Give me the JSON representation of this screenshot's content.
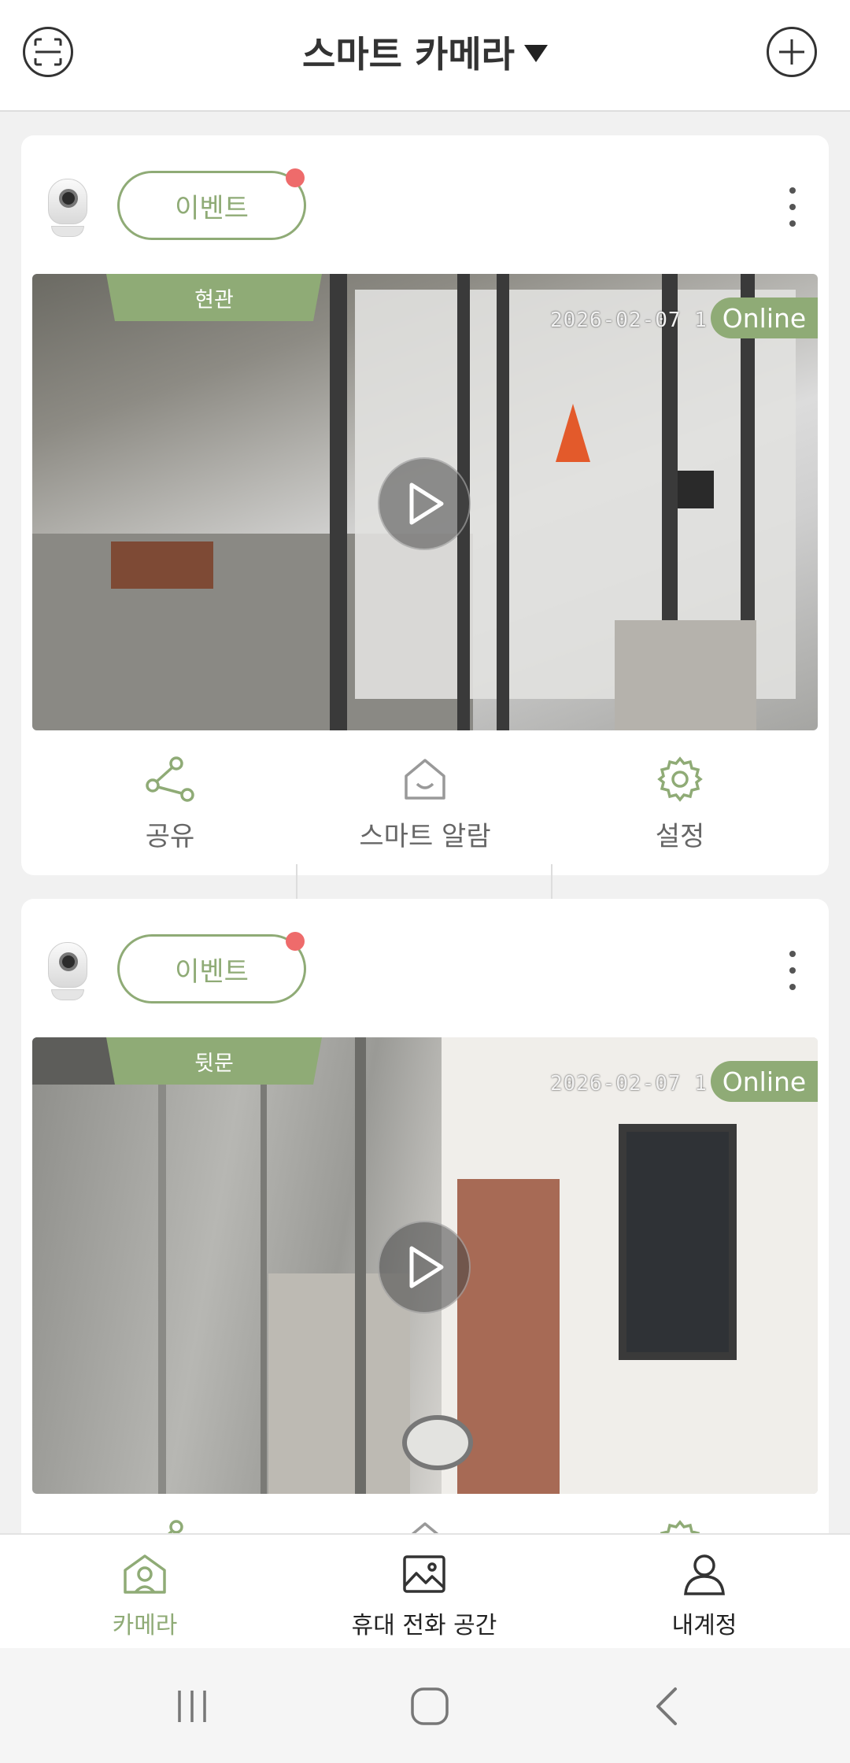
{
  "header": {
    "title": "스마트 카메라",
    "scan_icon": "scan-icon",
    "add_icon": "plus-icon"
  },
  "cameras": [
    {
      "event_label": "이벤트",
      "location": "현관",
      "timestamp": "2026-02-07  1",
      "status": "Online"
    },
    {
      "event_label": "이벤트",
      "location": "뒷문",
      "timestamp": "2026-02-07  1",
      "status": "Online"
    }
  ],
  "actions": {
    "share": "공유",
    "smart_alarm": "스마트 알람",
    "settings": "설정"
  },
  "bottom_nav": {
    "camera": "카메라",
    "phone_space": "휴대 전화 공간",
    "account": "내계정"
  },
  "colors": {
    "accent": "#8fab76",
    "event_dot": "#ee6b6b",
    "header_bg": "#ffffff",
    "page_bg": "#f1f1f1"
  }
}
